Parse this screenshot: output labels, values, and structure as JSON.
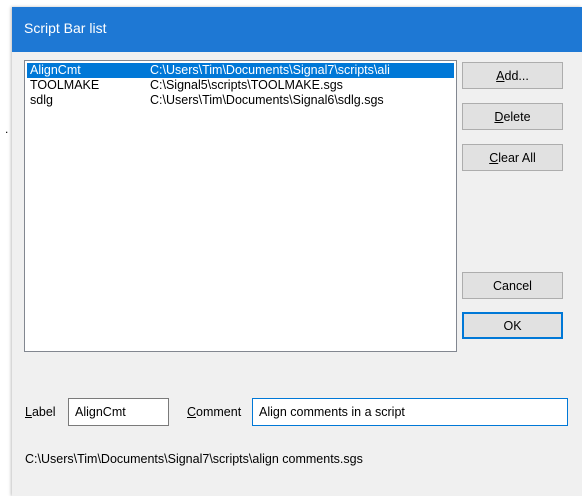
{
  "stray_mark": ".",
  "dialog": {
    "title": "Script Bar list"
  },
  "list": {
    "rows": [
      {
        "name": "AlignCmt",
        "path": "C:\\Users\\Tim\\Documents\\Signal7\\scripts\\ali",
        "selected": true
      },
      {
        "name": "TOOLMAKE",
        "path": "C:\\Signal5\\scripts\\TOOLMAKE.sgs",
        "selected": false
      },
      {
        "name": "sdlg",
        "path": "C:\\Users\\Tim\\Documents\\Signal6\\sdlg.sgs",
        "selected": false
      }
    ]
  },
  "buttons": {
    "add": {
      "underline": "A",
      "rest": "dd..."
    },
    "delete": {
      "underline": "D",
      "rest": "elete"
    },
    "clear_all": {
      "underline": "C",
      "rest": "lear All"
    },
    "cancel": "Cancel",
    "ok": "OK"
  },
  "fields": {
    "label_caption": {
      "underline": "L",
      "rest": "abel"
    },
    "label_value": "AlignCmt",
    "comment_caption": {
      "underline": "C",
      "rest": "omment"
    },
    "comment_value": "Align comments in a script"
  },
  "full_path": "C:\\Users\\Tim\\Documents\\Signal7\\scripts\\align comments.sgs",
  "colors": {
    "titlebar": "#1e78d4",
    "selection": "#0078d7",
    "dialog_bg": "#f0f0f0"
  }
}
